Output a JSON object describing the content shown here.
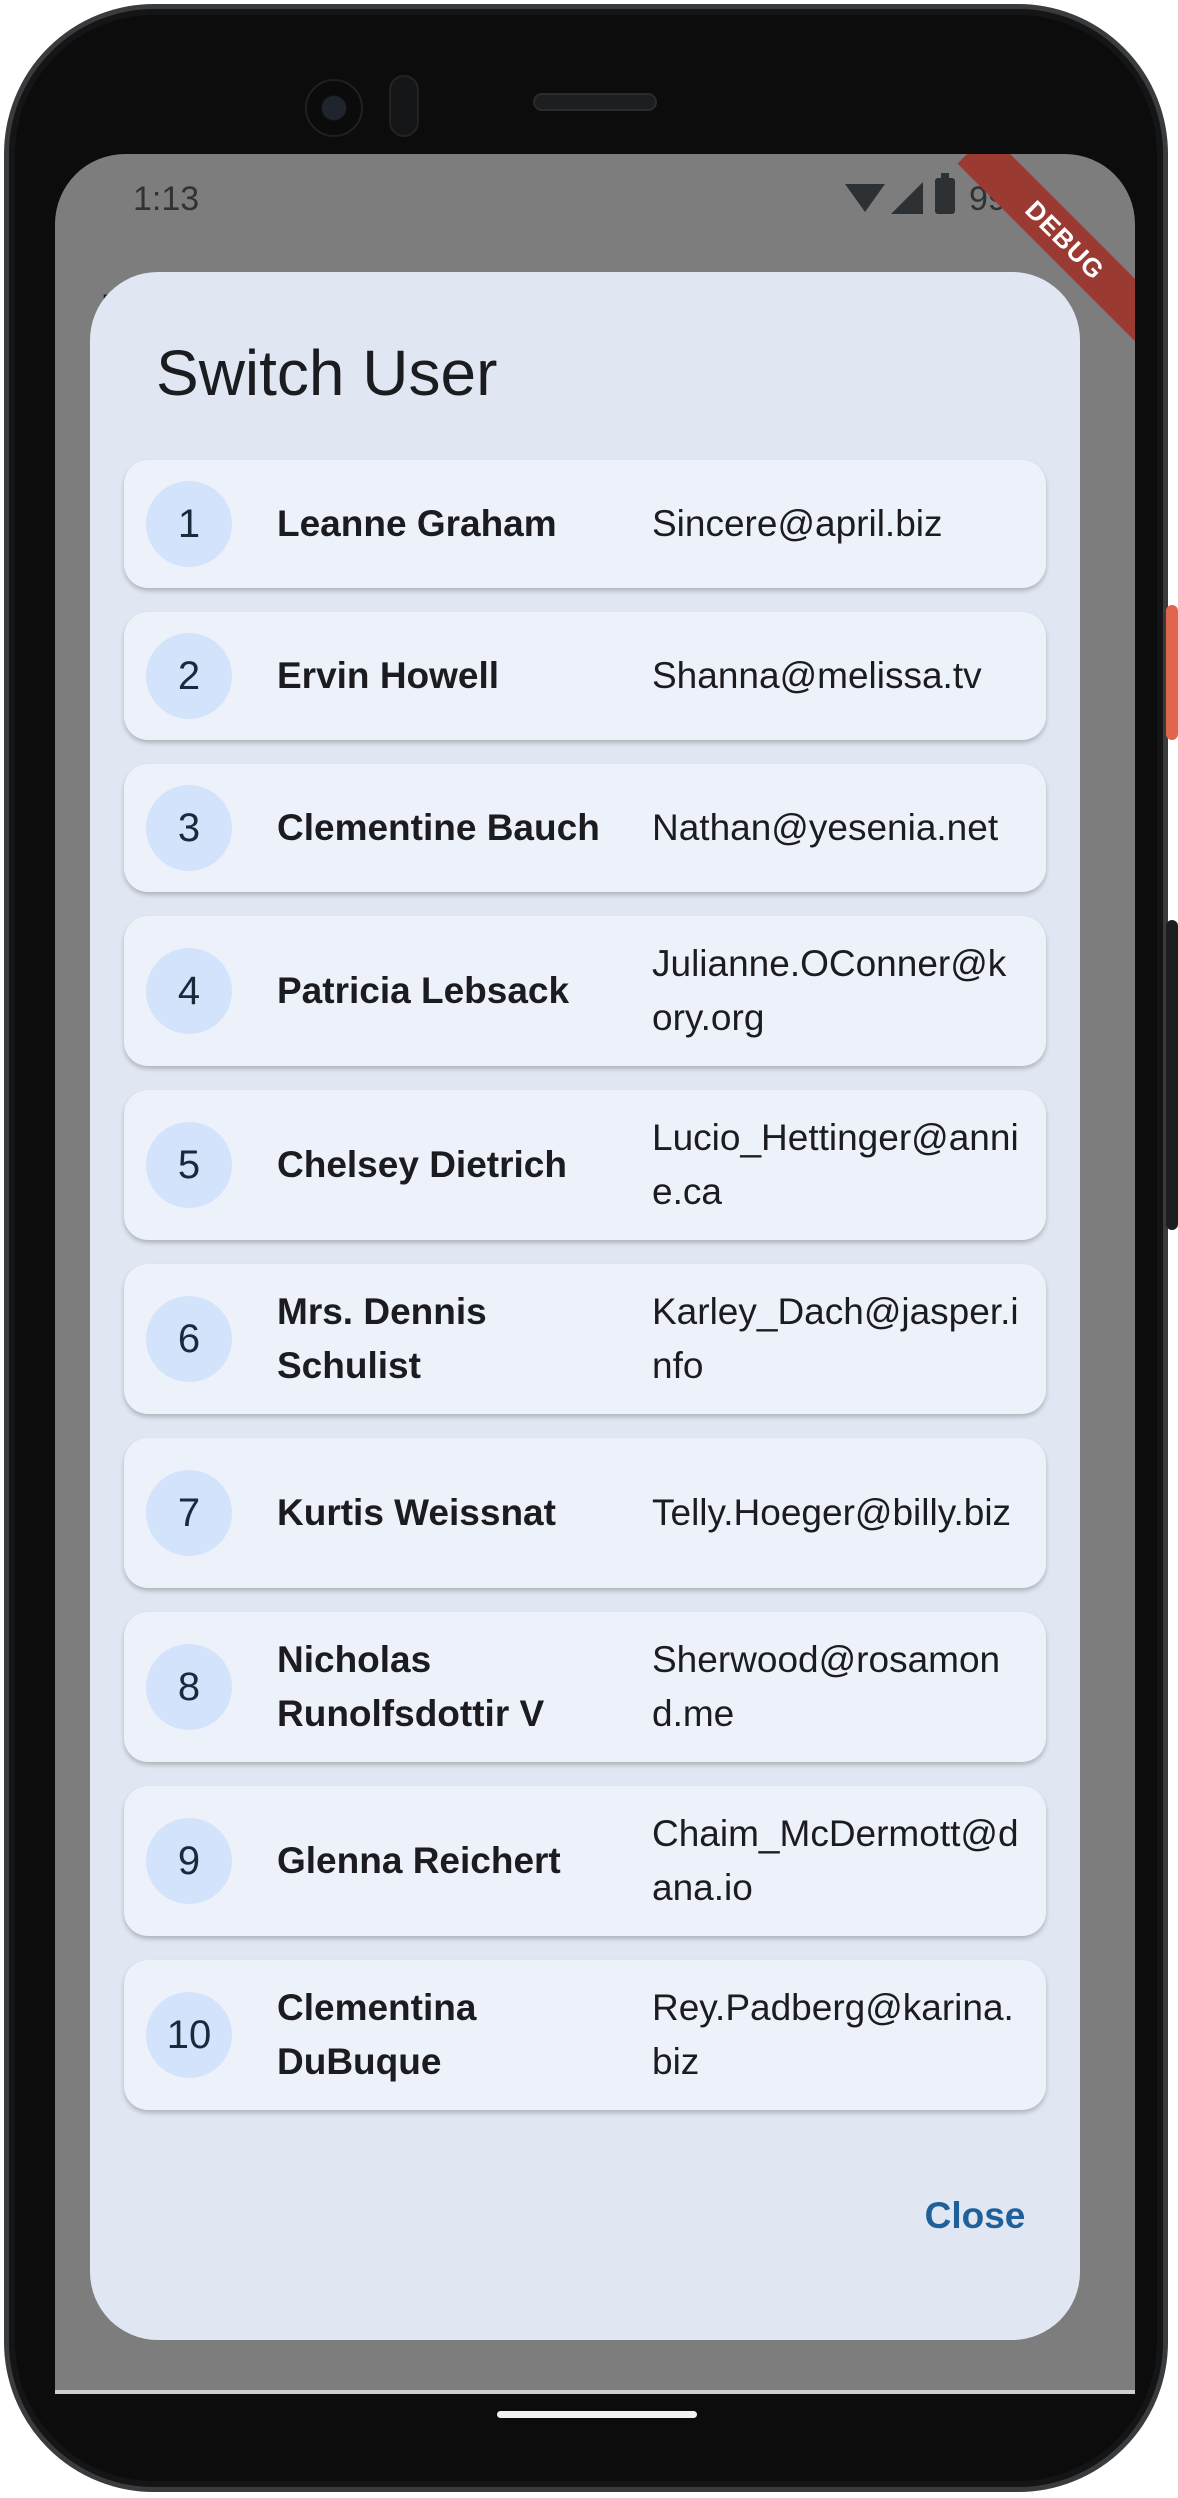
{
  "status_bar": {
    "time": "1:13",
    "battery_text": "99",
    "debug_label": "DEBUG"
  },
  "background": {
    "partial_title": "E"
  },
  "dialog": {
    "title": "Switch User",
    "close_label": "Close",
    "users": [
      {
        "id": "1",
        "name": "Leanne Graham",
        "email": "Sincere@april.biz"
      },
      {
        "id": "2",
        "name": "Ervin Howell",
        "email": "Shanna@melissa.tv"
      },
      {
        "id": "3",
        "name": "Clementine Bauch",
        "email": "Nathan@yesenia.net"
      },
      {
        "id": "4",
        "name": "Patricia Lebsack",
        "email": "Julianne.OConner@kory.org"
      },
      {
        "id": "5",
        "name": "Chelsey Dietrich",
        "email": "Lucio_Hettinger@annie.ca"
      },
      {
        "id": "6",
        "name": "Mrs. Dennis Schulist",
        "email": "Karley_Dach@jasper.info"
      },
      {
        "id": "7",
        "name": "Kurtis Weissnat",
        "email": "Telly.Hoeger@billy.biz"
      },
      {
        "id": "8",
        "name": "Nicholas Runolfsdottir V",
        "email": "Sherwood@rosamond.me"
      },
      {
        "id": "9",
        "name": "Glenna Reichert",
        "email": "Chaim_McDermott@dana.io"
      },
      {
        "id": "10",
        "name": "Clementina DuBuque",
        "email": "Rey.Padberg@karina.biz"
      }
    ]
  },
  "colors": {
    "dialog_bg": "#e1e7f2",
    "row_bg": "#edf1f9",
    "avatar_bg": "#d2e3fb",
    "accent": "#1f5f9a",
    "scrim": "#7d7d7d"
  }
}
